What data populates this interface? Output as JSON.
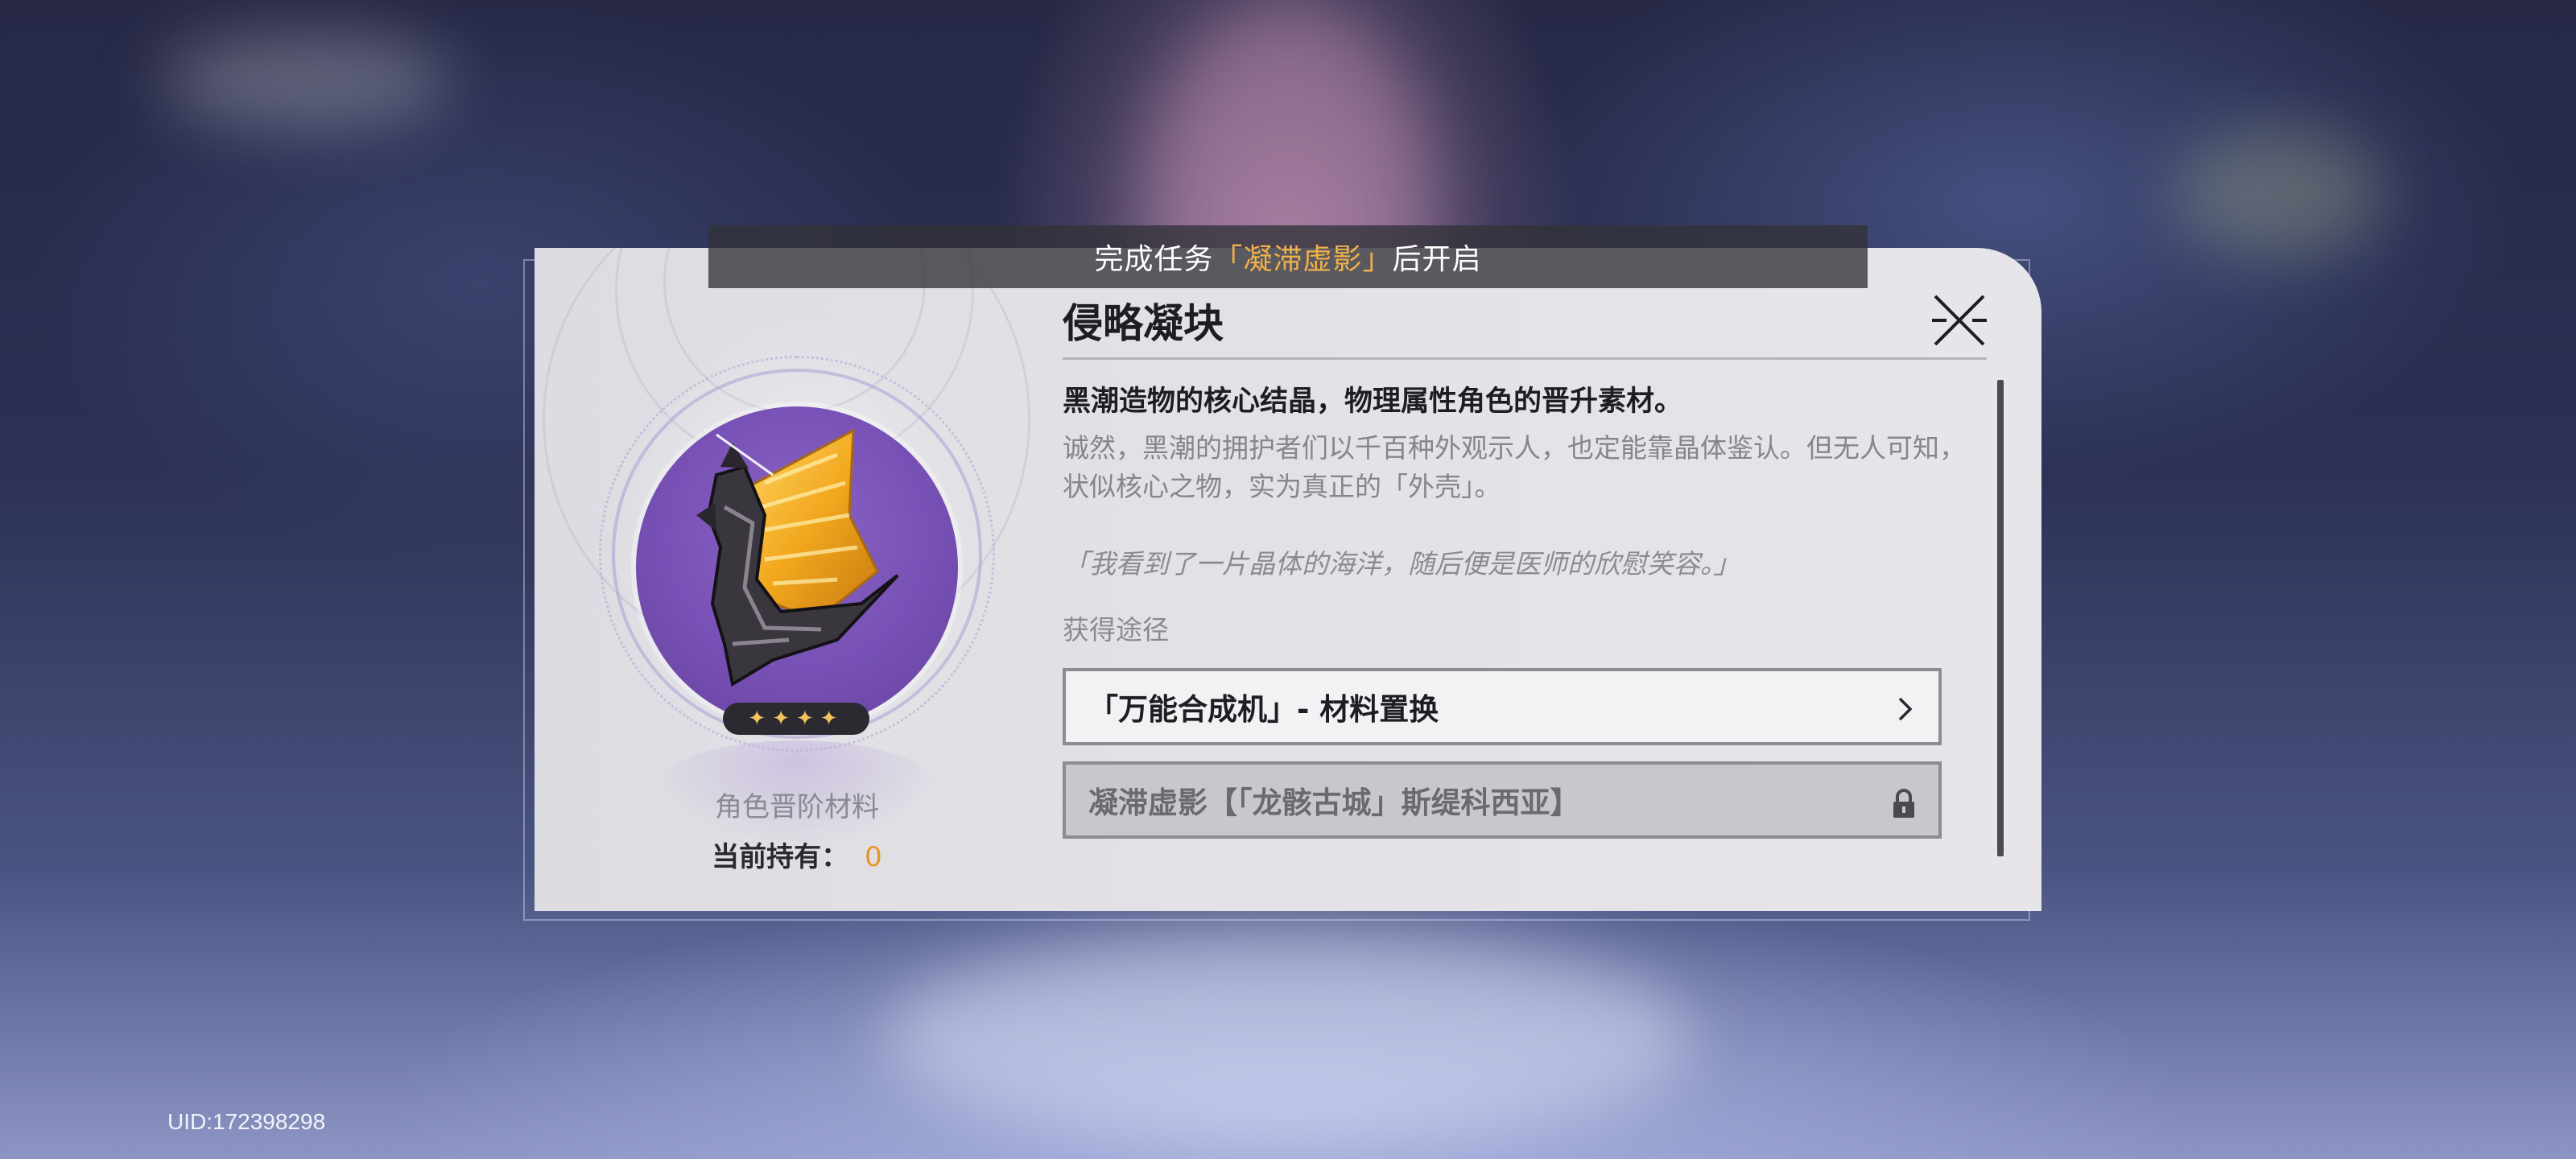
{
  "unlock_banner": {
    "prefix": "完成任务",
    "quest": "「凝滞虚影」",
    "suffix": "后开启"
  },
  "item": {
    "name": "侵略凝块",
    "rarity_stars": "✦✦✦✦",
    "type": "角色晋阶材料",
    "owned_label": "当前持有：",
    "owned_count": "0",
    "description": "黑潮造物的核心结晶，物理属性角色的晋升素材。",
    "lore": "诚然，黑潮的拥护者们以千百种外观示人，也定能靠晶体鉴认。但无人可知，状似核心之物，实为真正的「外壳」。",
    "quote": "「我看到了一片晶体的海洋，随后便是医师的欣慰笑容。」"
  },
  "sources": {
    "label": "获得途径",
    "entries": [
      {
        "text": "「万能合成机」- 材料置换",
        "locked": false
      },
      {
        "text": "凝滞虚影【「龙骸古城」斯缇科西亚】",
        "locked": true
      }
    ]
  },
  "icons": {
    "close": "close-icon",
    "chevron": "chevron-right-icon",
    "lock": "lock-icon"
  },
  "colors": {
    "highlight": "#f0b04a",
    "count": "#e8952a",
    "icon_bg": "#7650b4"
  },
  "uid": "UID:172398298"
}
